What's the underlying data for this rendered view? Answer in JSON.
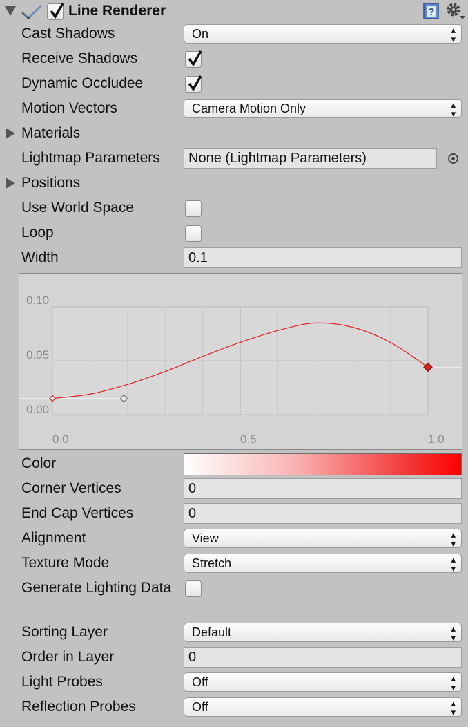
{
  "header": {
    "title": "Line Renderer",
    "enabled": true,
    "icons": {
      "component": "line-renderer-icon",
      "help": "help-book-icon",
      "settings": "gear-icon"
    }
  },
  "cast_shadows": {
    "label": "Cast Shadows",
    "value": "On"
  },
  "receive_shadows": {
    "label": "Receive Shadows",
    "checked": true
  },
  "dynamic_occludee": {
    "label": "Dynamic Occludee",
    "checked": true
  },
  "motion_vectors": {
    "label": "Motion Vectors",
    "value": "Camera Motion Only"
  },
  "materials": {
    "label": "Materials"
  },
  "lightmap_parameters": {
    "label": "Lightmap Parameters",
    "value": "None (Lightmap Parameters)"
  },
  "positions": {
    "label": "Positions"
  },
  "use_world_space": {
    "label": "Use World Space",
    "checked": false
  },
  "loop": {
    "label": "Loop",
    "checked": false
  },
  "width": {
    "label": "Width",
    "value": "0.1"
  },
  "chart_data": {
    "type": "line",
    "title": "",
    "xlabel": "",
    "ylabel": "",
    "x_ticks": [
      "0.0",
      "0.5",
      "1.0"
    ],
    "y_ticks": [
      "0.00",
      "0.05",
      "0.10"
    ],
    "xlim": [
      0,
      1
    ],
    "ylim": [
      0,
      0.1
    ],
    "grid": true,
    "series": [
      {
        "color": "#e02020",
        "x": [
          0.0,
          0.1,
          0.2,
          0.3,
          0.4,
          0.5,
          0.6,
          0.7,
          0.8,
          0.9,
          1.0
        ],
        "y": [
          0.015,
          0.019,
          0.028,
          0.04,
          0.054,
          0.067,
          0.078,
          0.085,
          0.081,
          0.067,
          0.044
        ]
      }
    ],
    "keys": [
      {
        "x": 0.0,
        "y": 0.015
      },
      {
        "x": 1.0,
        "y": 0.044
      }
    ],
    "tangent_handle": {
      "x": 0.19,
      "y": 0.015
    }
  },
  "color": {
    "label": "Color",
    "gradient": [
      "#ffffff",
      "#f9b3b3",
      "#f22b2b",
      "#ff0000"
    ]
  },
  "corner_vertices": {
    "label": "Corner Vertices",
    "value": "0"
  },
  "end_cap_vertices": {
    "label": "End Cap Vertices",
    "value": "0"
  },
  "alignment": {
    "label": "Alignment",
    "value": "View"
  },
  "texture_mode": {
    "label": "Texture Mode",
    "value": "Stretch"
  },
  "generate_lighting_data": {
    "label": "Generate Lighting Data",
    "checked": false
  },
  "sorting_layer": {
    "label": "Sorting Layer",
    "value": "Default"
  },
  "order_in_layer": {
    "label": "Order in Layer",
    "value": "0"
  },
  "light_probes": {
    "label": "Light Probes",
    "value": "Off"
  },
  "reflection_probes": {
    "label": "Reflection Probes",
    "value": "Off"
  },
  "dropdown_arrow_glyph": "▴▾"
}
